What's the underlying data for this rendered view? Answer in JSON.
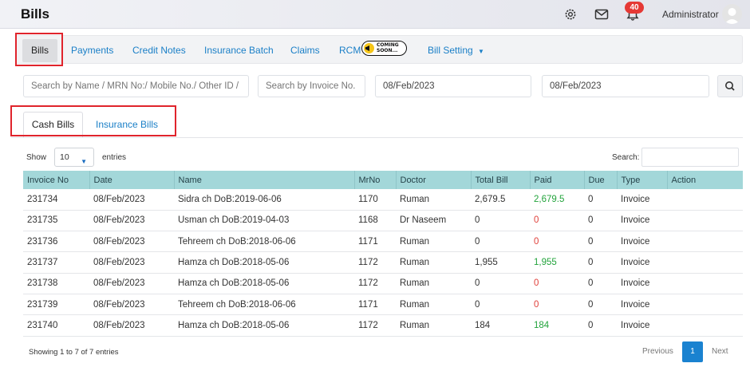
{
  "header": {
    "title": "Bills",
    "notification_count": "40",
    "user_name": "Administrator"
  },
  "nav": {
    "bills": "Bills",
    "payments": "Payments",
    "credit_notes": "Credit Notes",
    "insurance_batch": "Insurance Batch",
    "claims": "Claims",
    "rcm": "RCM",
    "coming_soon_line1": "COMING",
    "coming_soon_line2": "SOON...",
    "bill_setting": "Bill Setting"
  },
  "filters": {
    "search_name_placeholder": "Search by Name / MRN No:/ Mobile No./ Other ID / I",
    "search_invoice_placeholder": "Search by Invoice No.",
    "date_from": "08/Feb/2023",
    "date_to": "08/Feb/2023"
  },
  "subtabs": {
    "cash": "Cash Bills",
    "insurance": "Insurance Bills"
  },
  "table_controls": {
    "show_label": "Show",
    "entries_value": "10",
    "entries_label": "entries",
    "search_label": "Search:"
  },
  "table": {
    "columns": [
      "Invoice No",
      "Date",
      "Name",
      "MrNo",
      "Doctor",
      "Total Bill",
      "Paid",
      "Due",
      "Type",
      "Action"
    ],
    "rows": [
      [
        "231734",
        "08/Feb/2023",
        "Sidra ch DoB:2019-06-06",
        "1170",
        "Ruman",
        "2,679.5",
        "2,679.5",
        "0",
        "Invoice",
        ""
      ],
      [
        "231735",
        "08/Feb/2023",
        "Usman ch DoB:2019-04-03",
        "1168",
        "Dr Naseem",
        "0",
        "0",
        "0",
        "Invoice",
        ""
      ],
      [
        "231736",
        "08/Feb/2023",
        "Tehreem ch DoB:2018-06-06",
        "1171",
        "Ruman",
        "0",
        "0",
        "0",
        "Invoice",
        ""
      ],
      [
        "231737",
        "08/Feb/2023",
        "Hamza ch DoB:2018-05-06",
        "1172",
        "Ruman",
        "1,955",
        "1,955",
        "0",
        "Invoice",
        ""
      ],
      [
        "231738",
        "08/Feb/2023",
        "Hamza ch DoB:2018-05-06",
        "1172",
        "Ruman",
        "0",
        "0",
        "0",
        "Invoice",
        ""
      ],
      [
        "231739",
        "08/Feb/2023",
        "Tehreem ch DoB:2018-06-06",
        "1171",
        "Ruman",
        "0",
        "0",
        "0",
        "Invoice",
        ""
      ],
      [
        "231740",
        "08/Feb/2023",
        "Hamza ch DoB:2018-05-06",
        "1172",
        "Ruman",
        "184",
        "184",
        "0",
        "Invoice",
        ""
      ]
    ]
  },
  "footer": {
    "info": "Showing 1 to 7 of 7 entries",
    "previous": "Previous",
    "page": "1",
    "next": "Next"
  },
  "colors": {
    "accent": "#1a7fc7",
    "header_row": "#a3d7d9",
    "paid_positive": "#22a33b",
    "paid_zero": "#e0403a",
    "highlight_box": "#e0242c",
    "badge": "#e53935"
  },
  "icons": {
    "settings": "gear-icon",
    "mail": "mail-icon",
    "notifications": "bell-icon",
    "user": "avatar-icon",
    "search": "search-icon",
    "coming_soon": "megaphone-icon"
  }
}
